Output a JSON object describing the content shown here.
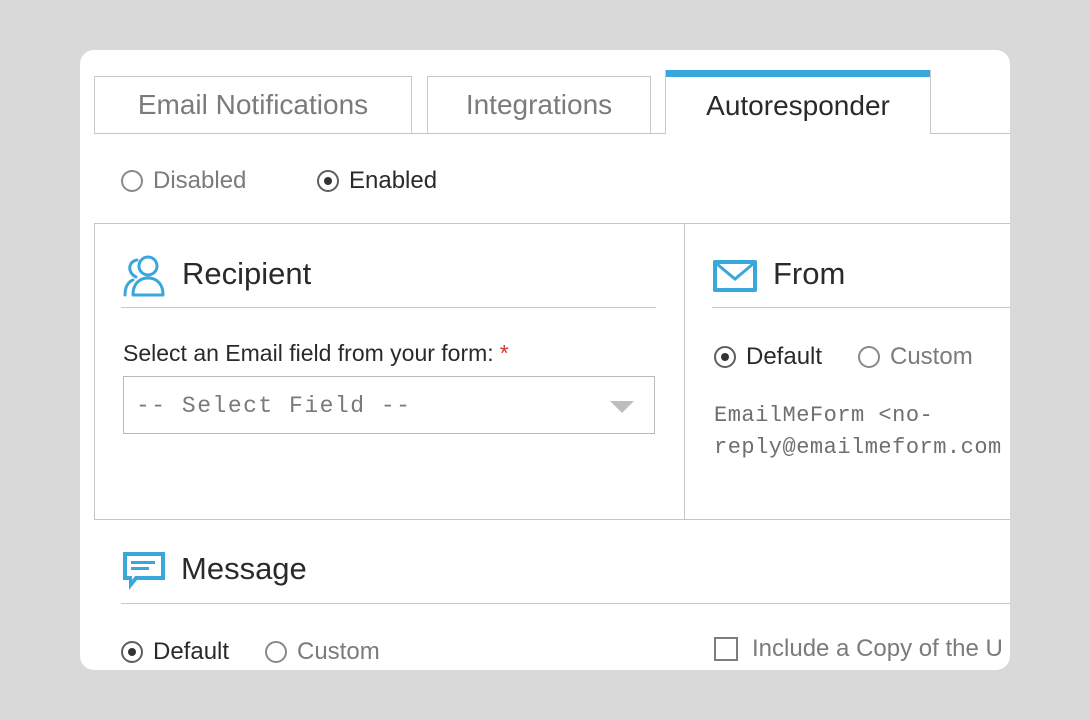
{
  "tabs": [
    {
      "label": "Email Notifications",
      "active": false
    },
    {
      "label": "Integrations",
      "active": false
    },
    {
      "label": "Autoresponder",
      "active": true
    }
  ],
  "status": {
    "disabled_label": "Disabled",
    "enabled_label": "Enabled",
    "selected": "Enabled"
  },
  "recipient": {
    "title": "Recipient",
    "field_label": "Select an Email field from your form:",
    "required_mark": "*",
    "select_value": "-- Select Field --"
  },
  "from": {
    "title": "From",
    "default_label": "Default",
    "custom_label": "Custom",
    "selected": "Default",
    "line1": "EmailMeForm <no-",
    "line2": "reply@emailmeform.com"
  },
  "message": {
    "title": "Message",
    "default_label": "Default",
    "custom_label": "Custom",
    "selected": "Default",
    "copy_checkbox_label": "Include a Copy of the U"
  },
  "colors": {
    "accent": "#3aa7db",
    "required": "#d9322b",
    "background": "#d9d9d9"
  },
  "icons": {
    "recipient": "users-icon",
    "from": "envelope-icon",
    "message": "chat-bubble-icon"
  }
}
